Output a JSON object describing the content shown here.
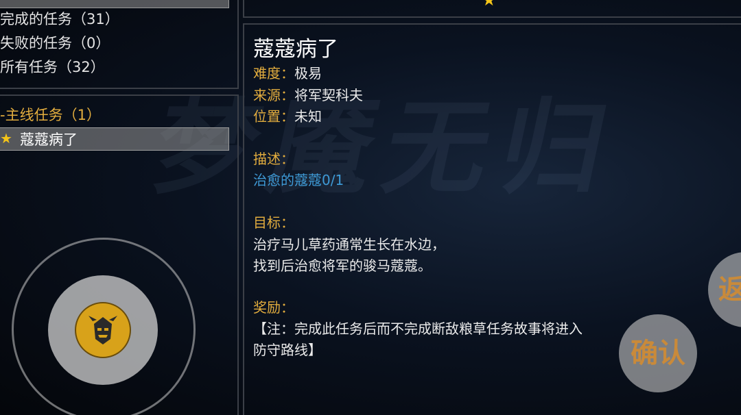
{
  "background": {
    "watermark": "梦魇无归"
  },
  "filters": [
    {
      "label": "完成的任务（31）"
    },
    {
      "label": "失败的任务（0）"
    },
    {
      "label": "所有任务（32）"
    }
  ],
  "quest_list": {
    "category": "-主线任务（1）",
    "selected_quest": "蔻蔻病了"
  },
  "quest_detail": {
    "title": "蔻蔻病了",
    "difficulty_label": "难度：",
    "difficulty": "极易",
    "source_label": "来源：",
    "source": "将军契科夫",
    "location_label": "位置：",
    "location": "未知",
    "description_label": "描述：",
    "description": "治愈的蔻蔻0/1",
    "goal_label": "目标：",
    "goal_lines": [
      "治疗马儿草药通常生长在水边，",
      "找到后治愈将军的骏马蔻蔻。"
    ],
    "reward_label": "奖励：",
    "reward_lines": [
      "【注：完成此任务后而不完成断敌粮草任务故事将进入",
      "防守路线】"
    ]
  },
  "buttons": {
    "confirm": "确认",
    "back": "返"
  },
  "colors": {
    "label_orange": "#e3ad3e",
    "link_blue": "#3e9ad6",
    "star_gold": "#f5c518",
    "panel_border": "#3b3f47"
  }
}
